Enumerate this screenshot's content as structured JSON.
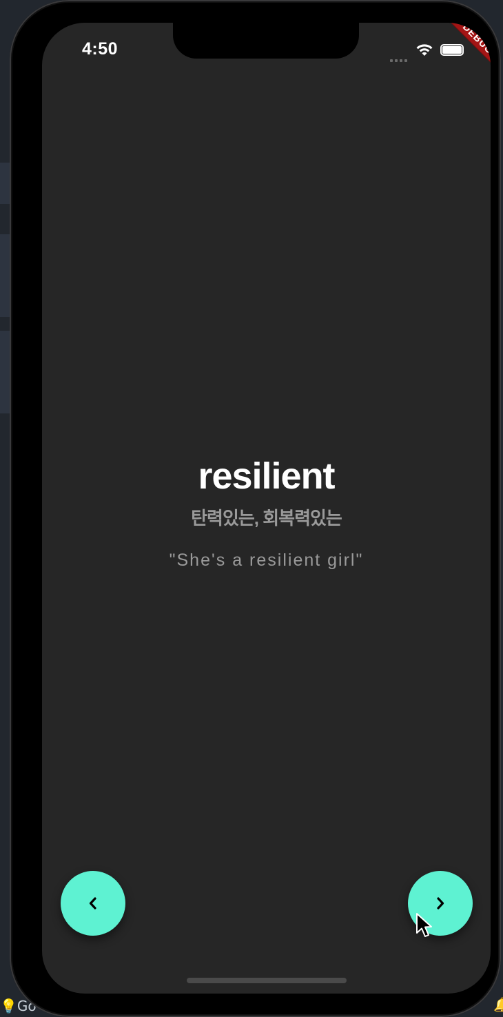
{
  "status_bar": {
    "time": "4:50",
    "debug_banner": "DEBUG"
  },
  "card": {
    "word": "resilient",
    "meaning": "탄력있는, 회복력있는",
    "example": "\"She's a resilient girl\""
  },
  "navigation": {
    "prev_icon": "chevron-left-icon",
    "next_icon": "chevron-right-icon",
    "button_color": "#5ef2d2"
  },
  "colors": {
    "screen_background": "#262626",
    "word": "#ffffff",
    "secondary_text": "#9a9a9a",
    "debug_ribbon": "#a31515"
  },
  "host_desktop": {
    "bottom_left_label": "Go"
  }
}
